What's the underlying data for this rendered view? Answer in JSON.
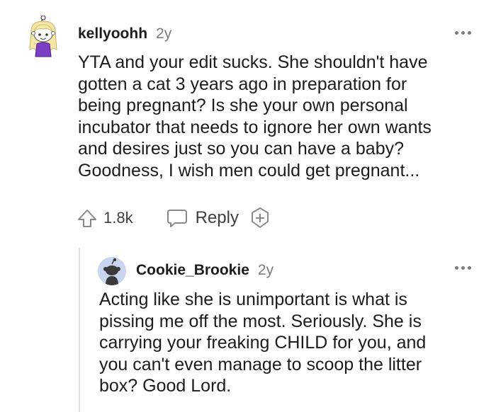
{
  "comment": {
    "username": "kellyoohh",
    "age": "2y",
    "body": "YTA and your edit sucks. She shouldn't have\ngotten a cat 3 years ago in preparation for\nbeing pregnant? Is she your own personal\nincubator that needs to ignore her own wants\nand desires just so you can have a baby?\nGoodness, I wish men could get pregnant...",
    "upvotes": "1.8k",
    "reply_label": "Reply"
  },
  "reply": {
    "username": "Cookie_Brookie",
    "age": "2y",
    "body": "Acting like she is unimportant is what is\npissing me off the most. Seriously. She is\ncarrying your freaking CHILD for you, and\nyou can't even manage to scoop the litter\nbox? Good Lord."
  },
  "colors": {
    "text": "#1c1c1c",
    "meta": "#7c7c7c",
    "action": "#3f3f3f",
    "avatar_bg": "#c9d5ee"
  }
}
